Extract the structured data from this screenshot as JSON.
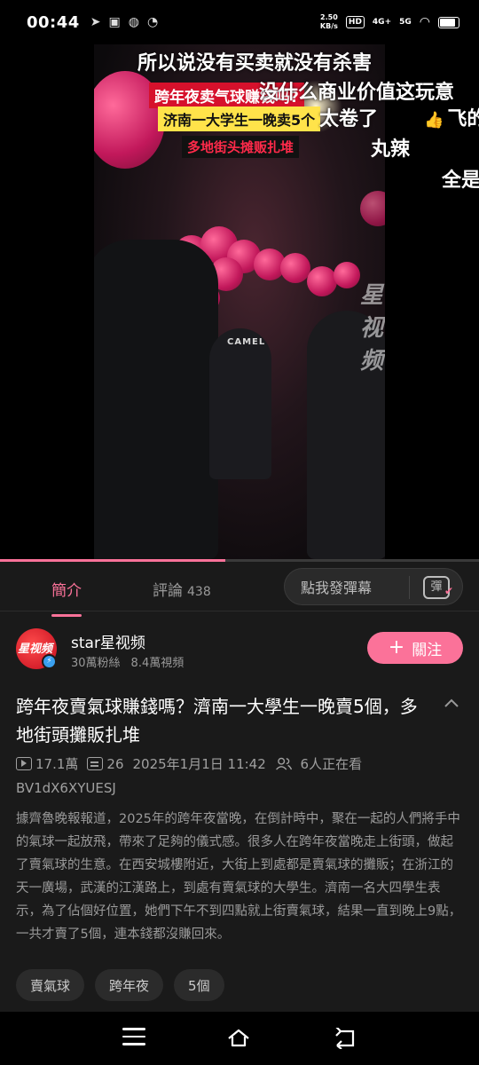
{
  "status_bar": {
    "time": "00:44",
    "net_speed_value": "2.50",
    "net_speed_unit": "KB/s",
    "hd_label": "HD",
    "signal1": "4G+",
    "signal2": "5G"
  },
  "video": {
    "captions": [
      "所以说没有买卖就没有杀害",
      "跨年夜卖气球赚钱吗?",
      "没什么商业价值这玩意",
      "济南一大学生一晚卖5个",
      "太卷了",
      "多地街头摊贩扎堆",
      "飞的",
      "丸辣",
      "全是"
    ],
    "watermark": "星视频",
    "jacket_logo": "CAMEL",
    "progress_fraction": 0.47
  },
  "tabs": {
    "intro_label": "簡介",
    "comments_label": "評論",
    "comments_count": "438",
    "danmaku_placeholder": "點我發彈幕",
    "danmaku_icon_text": "彈"
  },
  "uploader": {
    "name": "star星视频",
    "avatar_text": "星视频",
    "followers": "30萬粉絲",
    "videos": "8.4萬視頻",
    "follow_label": "關注"
  },
  "video_info": {
    "title": "跨年夜賣氣球賺錢嗎？濟南一大學生一晚賣5個，多地街頭攤販扎堆",
    "views": "17.1萬",
    "danmaku_count": "26",
    "date": "2025年1月1日 11:42",
    "watching": "6人正在看",
    "bvid": "BV1dX6XYUESJ",
    "description": "據齊魯晚報報道，2025年的跨年夜當晚，在倒計時中，聚在一起的人們將手中的氣球一起放飛，帶來了足夠的儀式感。很多人在跨年夜當晚走上街頭，做起了賣氣球的生意。在西安城樓附近，大街上到處都是賣氣球的攤販；在浙江的天一廣場，武漢的江漢路上，到處有賣氣球的大學生。濟南一名大四學生表示，為了佔個好位置，她們下午不到四點就上街賣氣球，結果一直到晚上9點，一共才賣了5個，連本錢都沒賺回來。",
    "tags": [
      "賣氣球",
      "跨年夜",
      "5個"
    ]
  },
  "colors": {
    "accent": "#fb7299",
    "background": "#1a1a1a"
  }
}
